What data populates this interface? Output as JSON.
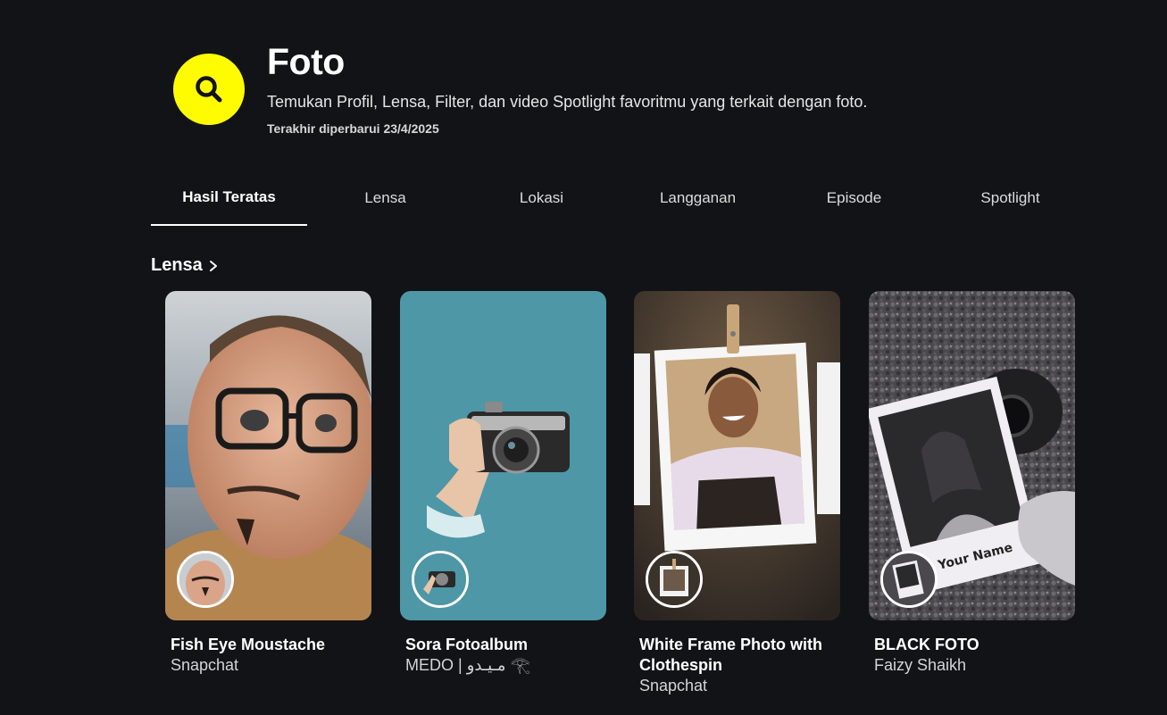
{
  "header": {
    "title": "Foto",
    "subtitle": "Temukan Profil, Lensa, Filter, dan video Spotlight favoritmu yang terkait dengan foto.",
    "updated": "Terakhir diperbarui 23/4/2025",
    "icon": "search-icon",
    "accent_color": "#fffc00"
  },
  "tabs": [
    {
      "label": "Hasil Teratas",
      "active": true
    },
    {
      "label": "Lensa",
      "active": false
    },
    {
      "label": "Lokasi",
      "active": false
    },
    {
      "label": "Langganan",
      "active": false
    },
    {
      "label": "Episode",
      "active": false
    },
    {
      "label": "Spotlight",
      "active": false
    }
  ],
  "section": {
    "title": "Lensa",
    "icon": "chevron-right-icon"
  },
  "lenses": [
    {
      "title": "Fish Eye Moustache",
      "creator": "Snapchat"
    },
    {
      "title": "Sora Fotoalbum",
      "creator": "MEDO | مـيـدو 𓂀"
    },
    {
      "title": "White Frame Photo with Clothespin",
      "creator": "Snapchat"
    },
    {
      "title": "BLACK FOTO",
      "creator": "Faizy Shaikh"
    }
  ]
}
